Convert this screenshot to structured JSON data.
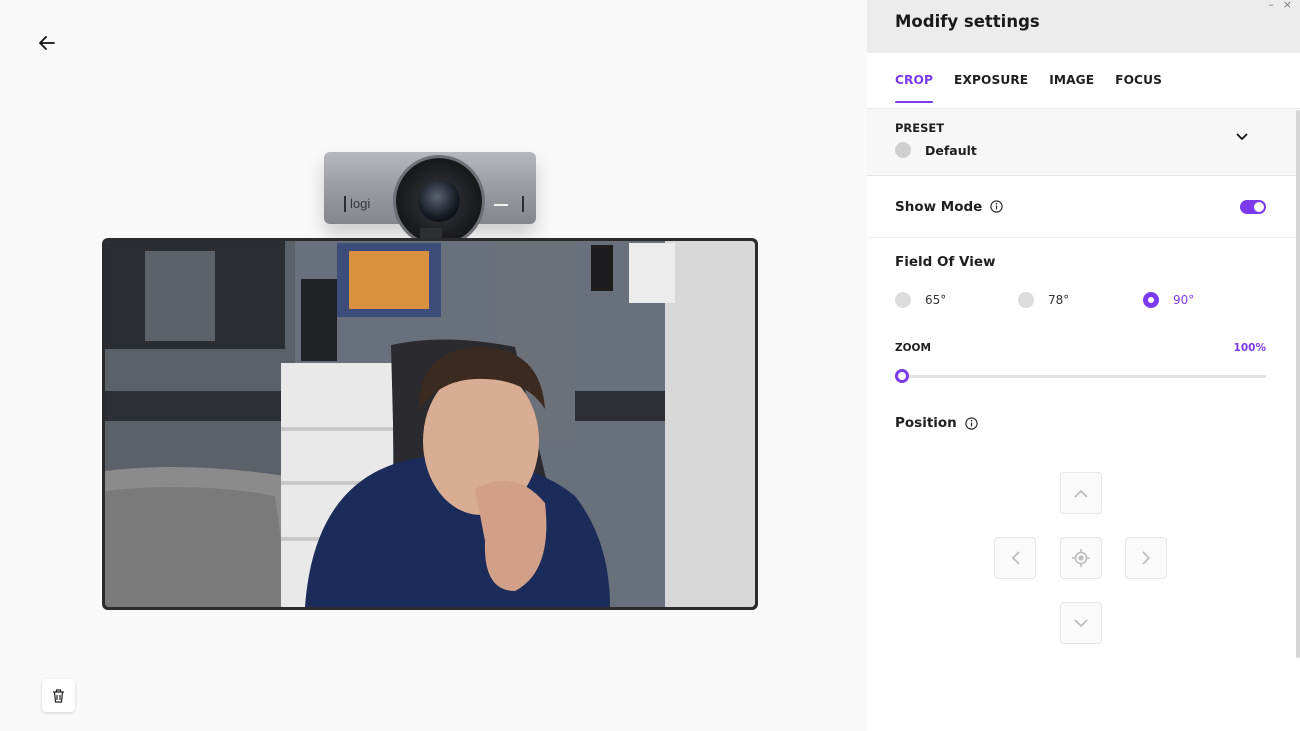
{
  "panel": {
    "title": "Modify settings",
    "window_minimize": "–",
    "window_close": "×"
  },
  "tabs": [
    {
      "label": "CROP",
      "active": true
    },
    {
      "label": "EXPOSURE",
      "active": false
    },
    {
      "label": "IMAGE",
      "active": false
    },
    {
      "label": "FOCUS",
      "active": false
    }
  ],
  "preset": {
    "label": "PRESET",
    "value": "Default"
  },
  "show_mode": {
    "label": "Show Mode",
    "enabled": true
  },
  "field_of_view": {
    "label": "Field Of View",
    "options": [
      "65°",
      "78°",
      "90°"
    ],
    "selected": "90°"
  },
  "zoom": {
    "label": "ZOOM",
    "value_label": "100%",
    "level": 0.0
  },
  "position": {
    "label": "Position"
  },
  "device": {
    "logo": "logi"
  },
  "colors": {
    "accent": "#7c3aed"
  },
  "icons": {
    "back": "arrow-left-icon",
    "info": "info-icon",
    "chevron": "chevron-down-icon",
    "delete": "trash-icon",
    "center": "crosshair-icon"
  }
}
